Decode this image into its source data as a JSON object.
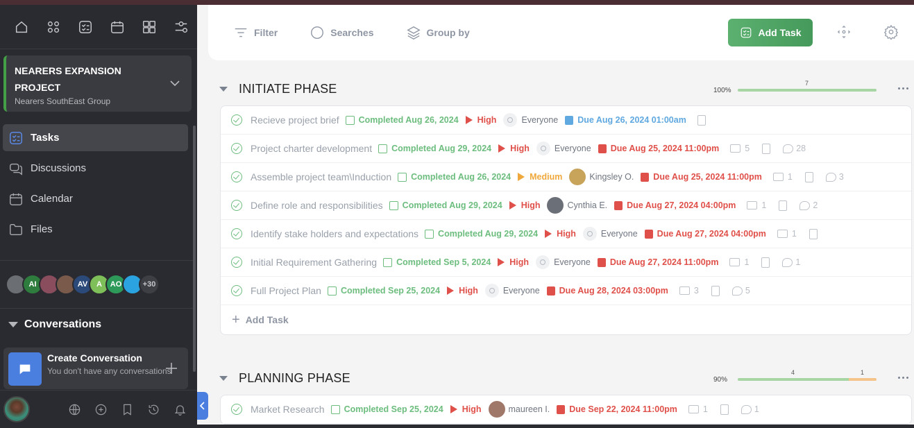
{
  "sidebar": {
    "project": {
      "name": "NEARERS EXPANSION PROJECT",
      "group": "Nearers SouthEast Group"
    },
    "nav": [
      {
        "label": "Tasks",
        "icon": "tasks-icon"
      },
      {
        "label": "Discussions",
        "icon": "discussions-icon"
      },
      {
        "label": "Calendar",
        "icon": "calendar-icon"
      },
      {
        "label": "Files",
        "icon": "folder-icon"
      }
    ],
    "members": [
      {
        "initials": "",
        "color": "#6b6f73"
      },
      {
        "initials": "AI",
        "color": "#2e7d3e"
      },
      {
        "initials": "",
        "color": "#8a4d5e"
      },
      {
        "initials": "",
        "color": "#7a5a4a"
      },
      {
        "initials": "AV",
        "color": "#2b4a7a"
      },
      {
        "initials": "A",
        "color": "#7fbf5a"
      },
      {
        "initials": "AO",
        "color": "#2e9a5a"
      },
      {
        "initials": "",
        "color": "#2aa3e0"
      }
    ],
    "members_more": "+30",
    "conversations_label": "Conversations",
    "create_conv": {
      "title": "Create Conversation",
      "subtitle": "You don't have any conversations"
    }
  },
  "toolbar": {
    "filter": "Filter",
    "searches": "Searches",
    "group_by": "Group by",
    "add_task": "Add Task"
  },
  "phases": [
    {
      "title": "INITIATE PHASE",
      "percent": "100%",
      "progress": {
        "done": 7,
        "pending": 0
      },
      "done_label": "7",
      "add_task": "Add Task",
      "tasks": [
        {
          "name": "Recieve project brief",
          "completed": "Completed Aug 26, 2024",
          "priority": "High",
          "assignee": "Everyone",
          "due": "Due Aug 26, 2024 01:00am",
          "due_color": "blue",
          "folders": null,
          "comments": null
        },
        {
          "name": "Project charter development",
          "completed": "Completed Aug 29, 2024",
          "priority": "High",
          "assignee": "Everyone",
          "due": "Due Aug 25, 2024 11:00pm",
          "due_color": "red",
          "folders": "5",
          "comments": "28"
        },
        {
          "name": "Assemble project team\\Induction",
          "completed": "Completed Aug 26, 2024",
          "priority": "Medium",
          "assignee": "Kingsley O.",
          "due": "Due Aug 25, 2024 11:00pm",
          "due_color": "red",
          "folders": "1",
          "comments": "3"
        },
        {
          "name": "Define role and responsibilities",
          "completed": "Completed Aug 29, 2024",
          "priority": "High",
          "assignee": "Cynthia E.",
          "due": "Due Aug 27, 2024 04:00pm",
          "due_color": "red",
          "folders": "1",
          "comments": "2"
        },
        {
          "name": "Identify stake holders and expectations",
          "completed": "Completed Aug 29, 2024",
          "priority": "High",
          "assignee": "Everyone",
          "due": "Due Aug 27, 2024 04:00pm",
          "due_color": "red",
          "folders": "1",
          "comments": null
        },
        {
          "name": "Initial Requirement Gathering",
          "completed": "Completed Sep 5, 2024",
          "priority": "High",
          "assignee": "Everyone",
          "due": "Due Aug 27, 2024 11:00pm",
          "due_color": "red",
          "folders": "1",
          "comments": "1"
        },
        {
          "name": "Full Project Plan",
          "completed": "Completed Sep 25, 2024",
          "priority": "High",
          "assignee": "Everyone",
          "due": "Due Aug 28, 2024 03:00pm",
          "due_color": "red",
          "folders": "3",
          "comments": "5"
        }
      ]
    },
    {
      "title": "PLANNING PHASE",
      "percent": "90%",
      "progress": {
        "done": 4,
        "pending": 1
      },
      "done_label": "4",
      "pending_label": "1",
      "tasks": [
        {
          "name": "Market Research",
          "completed": "Completed Sep 25, 2024",
          "priority": "High",
          "assignee": "maureen I.",
          "due": "Due Sep 22, 2024 11:00pm",
          "due_color": "red",
          "folders": "1",
          "comments": "1"
        }
      ]
    }
  ],
  "colors": {
    "accent_green": "#5cb070",
    "high": "#e0504a",
    "medium": "#f0a83c",
    "due_blue": "#5fa8e0",
    "sidebar_bg": "#2a2b30"
  }
}
